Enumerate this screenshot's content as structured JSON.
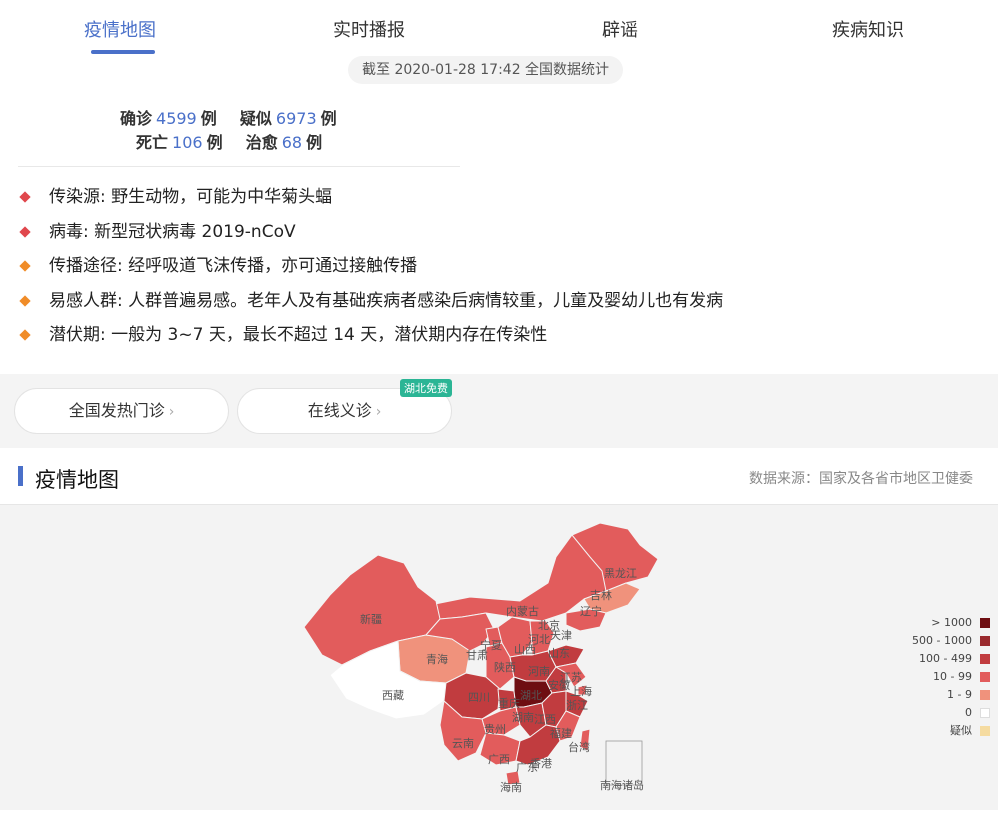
{
  "tabs": [
    {
      "label": "疫情地图"
    },
    {
      "label": "实时播报"
    },
    {
      "label": "辟谣"
    },
    {
      "label": "疾病知识"
    }
  ],
  "update_notice": "截至 2020-01-28 17:42 全国数据统计",
  "stats": {
    "confirmed_label": "确诊",
    "confirmed_value": "4599",
    "confirmed_unit": "例",
    "suspected_label": "疑似",
    "suspected_value": "6973",
    "suspected_unit": "例",
    "deaths_label": "死亡",
    "deaths_value": "106",
    "deaths_unit": "例",
    "cured_label": "治愈",
    "cured_value": "68",
    "cured_unit": "例"
  },
  "facts": [
    {
      "text": "传染源: 野生动物，可能为中华菊头蝠",
      "color": "#e0474c"
    },
    {
      "text": "病毒: 新型冠状病毒 2019-nCoV",
      "color": "#e0474c"
    },
    {
      "text": "传播途径: 经呼吸道飞沫传播，亦可通过接触传播",
      "color": "#f08c28"
    },
    {
      "text": "易感人群: 人群普遍易感。老年人及有基础疾病者感染后病情较重，儿童及婴幼儿也有发病",
      "color": "#f08c28"
    },
    {
      "text": "潜伏期: 一般为 3~7 天，最长不超过 14 天，潜伏期内存在传染性",
      "color": "#f08c28"
    }
  ],
  "buttons": {
    "fever_clinic": "全国发热门诊",
    "online_consult": "在线义诊",
    "hubei_free_badge": "湖北免费",
    "chevron": "›"
  },
  "section": {
    "title": "疫情地图",
    "data_source": "数据来源：国家及各省市地区卫健委"
  },
  "map": {
    "regions": [
      "黑龙江",
      "吉林",
      "辽宁",
      "内蒙古",
      "新疆",
      "北京",
      "天津",
      "河北",
      "山西",
      "山东",
      "宁夏",
      "甘肃",
      "青海",
      "陕西",
      "河南",
      "江苏",
      "上海",
      "湖北",
      "安徽",
      "四川",
      "重庆",
      "西藏",
      "浙江",
      "贵州",
      "湖南",
      "江西",
      "云南",
      "福建",
      "广西",
      "广东",
      "台湾",
      "香港",
      "海南",
      "南海诸岛"
    ],
    "legend": [
      {
        "label": "> 1000",
        "color": "#6e0e12"
      },
      {
        "label": "500 - 1000",
        "color": "#9a2a2e"
      },
      {
        "label": "100 - 499",
        "color": "#c13c3f"
      },
      {
        "label": "10 - 99",
        "color": "#e25c5c"
      },
      {
        "label": "1 - 9",
        "color": "#f0927c"
      },
      {
        "label": "0",
        "color": "#ffffff"
      },
      {
        "label": "疑似",
        "color": "#f5dba0"
      }
    ]
  }
}
